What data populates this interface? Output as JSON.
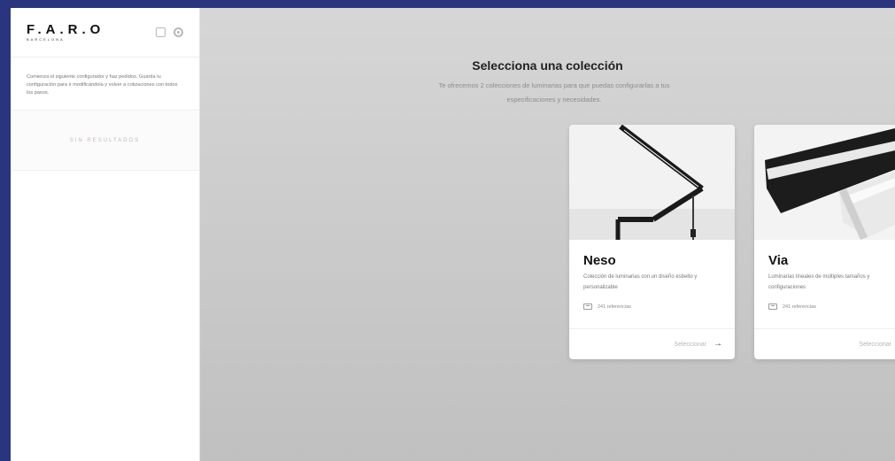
{
  "app": {
    "logo_main": "F.A.R.O",
    "logo_sub": "BARCELONA"
  },
  "sidebar": {
    "description": "Comienza el siguiente configurador y haz pedidos. Guarda tu configuración para ir modificándola y volver a cotizaciones con todos los pasos.",
    "empty_label": "SIN RESULTADOS",
    "icons": [
      "square-icon",
      "gear-icon"
    ]
  },
  "main": {
    "title": "Selecciona una colección",
    "subtitle": "Te ofrecemos 2 colecciones de luminarias para que puedas configurarlas a tus especificaciones y necesidades."
  },
  "collections": [
    {
      "name": "Neso",
      "description": "Colección de luminarias con un diseño esbelto y personalizable",
      "refs": "241 referencias",
      "action": "Seleccionar"
    },
    {
      "name": "Via",
      "description": "Luminarias lineales de múltiples tamaños y configuraciones",
      "refs": "241 referencias",
      "action": "Seleccionar"
    }
  ],
  "colors": {
    "frame_border": "#2a3580",
    "background": "#cccccc"
  }
}
